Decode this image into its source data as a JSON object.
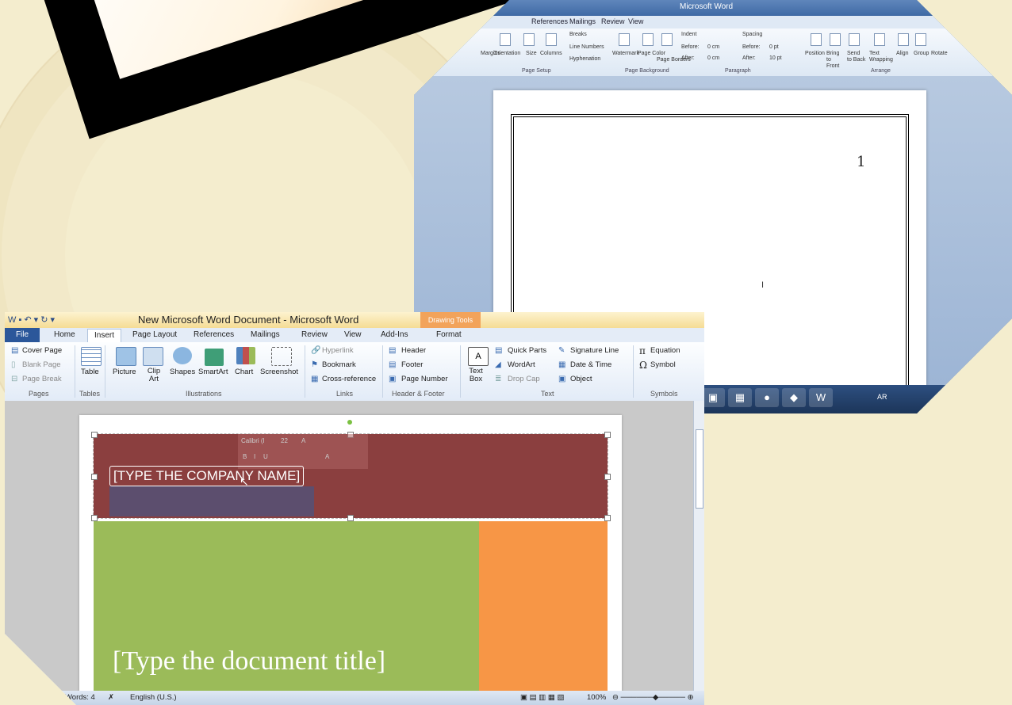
{
  "back_window": {
    "title": "Microsoft Word",
    "tabs": [
      "References",
      "Mailings",
      "Review",
      "View"
    ],
    "ribbon": {
      "page_setup_items": [
        "Margins",
        "Orientation",
        "Size",
        "Columns"
      ],
      "breaks": "Breaks",
      "line_numbers": "Line Numbers",
      "hyphenation": "Hyphenation",
      "page_setup_label": "Page Setup",
      "background_items": [
        "Watermark",
        "Page Color",
        "Page Borders"
      ],
      "background_label": "Page Background",
      "indent_label": "Indent",
      "indent_before_label": "Before:",
      "indent_before_value": "0 cm",
      "indent_after_label": "After:",
      "indent_after_value": "0 cm",
      "spacing_label": "Spacing",
      "spacing_before_label": "Before:",
      "spacing_before_value": "0 pt",
      "spacing_after_label": "After:",
      "spacing_after_value": "10 pt",
      "paragraph_label": "Paragraph",
      "arrange_items": [
        "Position",
        "Bring to Front",
        "Send to Back",
        "Text Wrapping",
        "Align",
        "Group",
        "Rotate"
      ],
      "arrange_label": "Arrange"
    },
    "page_number": "1",
    "taskbar_lang": "AR"
  },
  "front_window": {
    "title": "New Microsoft Word Document - Microsoft Word",
    "contextual_tab": "Drawing Tools",
    "tabs": {
      "file": "File",
      "home": "Home",
      "insert": "Insert",
      "page_layout": "Page Layout",
      "references": "References",
      "mailings": "Mailings",
      "review": "Review",
      "view": "View",
      "addins": "Add-Ins",
      "format": "Format"
    },
    "ribbon": {
      "pages": {
        "cover_page": "Cover Page",
        "blank_page": "Blank Page",
        "page_break": "Page Break",
        "label": "Pages"
      },
      "tables": {
        "table": "Table",
        "label": "Tables"
      },
      "illustrations": {
        "picture": "Picture",
        "clip_art": "Clip Art",
        "shapes": "Shapes",
        "smartart": "SmartArt",
        "chart": "Chart",
        "screenshot": "Screenshot",
        "label": "Illustrations"
      },
      "links": {
        "hyperlink": "Hyperlink",
        "bookmark": "Bookmark",
        "cross_reference": "Cross-reference",
        "label": "Links"
      },
      "header_footer": {
        "header": "Header",
        "footer": "Footer",
        "page_number": "Page Number",
        "label": "Header & Footer"
      },
      "text": {
        "text_box": "Text Box",
        "quick_parts": "Quick Parts",
        "wordart": "WordArt",
        "drop_cap": "Drop Cap",
        "signature_line": "Signature Line",
        "date_time": "Date & Time",
        "object": "Object",
        "label": "Text"
      },
      "symbols": {
        "equation": "Equation",
        "symbol": "Symbol",
        "label": "Symbols"
      }
    },
    "mini_toolbar": {
      "font": "Calibri (I",
      "size": "22"
    },
    "document": {
      "company_name": "[TYPE THE COMPANY NAME]",
      "doc_title": "[Type the document title]"
    },
    "status": {
      "words": "Words: 4",
      "language": "English (U.S.)",
      "zoom": "100%"
    }
  },
  "colors": {
    "banner": "#8b3f3f",
    "green_block": "#9bbb59",
    "orange_block": "#f79646",
    "file_tab": "#2b579a",
    "drawing_tools": "#f2a35b"
  }
}
